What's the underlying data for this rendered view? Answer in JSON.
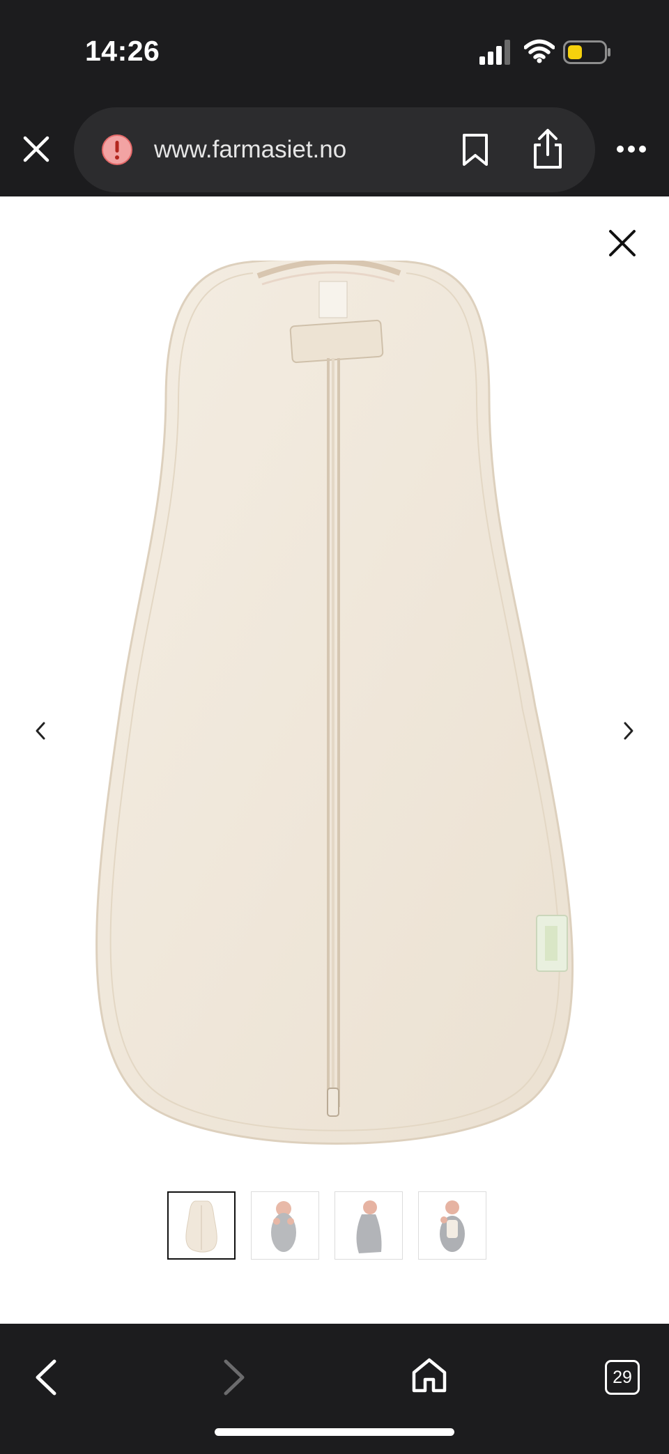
{
  "status_bar": {
    "time": "14:26",
    "icons": [
      "cellular-signal-icon",
      "wifi-icon",
      "battery-icon"
    ],
    "battery_color": "#f5d10d"
  },
  "browser": {
    "url": "www.farmasiet.no",
    "security_icon": "warning-icon",
    "security_color": "#f2a3a3",
    "actions": [
      "bookmark-icon",
      "share-icon",
      "more-icon"
    ]
  },
  "gallery": {
    "image_alt": "Swaddle sack, oatmeal colour, front zipper",
    "thumbnail_count": 4,
    "active_thumbnail": 1,
    "controls": [
      "close-icon",
      "chevron-left-icon",
      "chevron-right-icon"
    ]
  },
  "toolbar": {
    "tab_count": "29",
    "items": [
      "back-icon",
      "forward-icon",
      "home-icon",
      "tabs-icon"
    ]
  }
}
